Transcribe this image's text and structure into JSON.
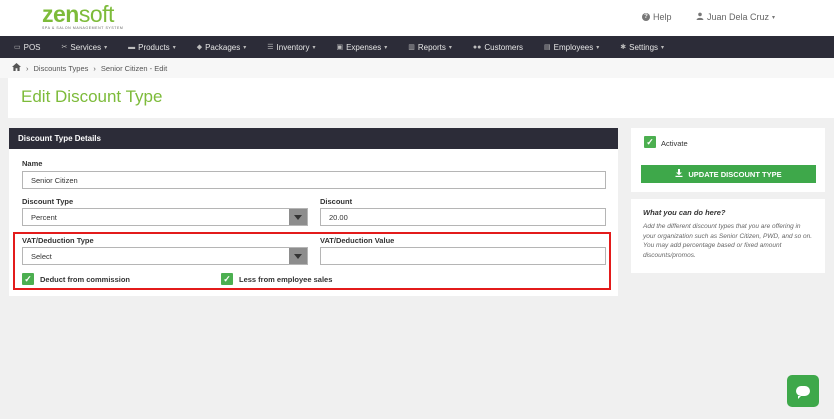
{
  "brand": {
    "name_part1": "zen",
    "name_part2": "soft",
    "tagline": "SPA & SALON MANAGEMENT SYSTEM"
  },
  "header": {
    "help_label": "Help",
    "user_name": "Juan Dela Cruz"
  },
  "nav": {
    "items": [
      {
        "icon": "tablet-icon",
        "label": "POS",
        "has_caret": false
      },
      {
        "icon": "wrench-icon",
        "label": "Services",
        "has_caret": true
      },
      {
        "icon": "cart-icon",
        "label": "Products",
        "has_caret": true
      },
      {
        "icon": "tag-icon",
        "label": "Packages",
        "has_caret": true
      },
      {
        "icon": "list-icon",
        "label": "Inventory",
        "has_caret": true
      },
      {
        "icon": "money-icon",
        "label": "Expenses",
        "has_caret": true
      },
      {
        "icon": "bar-chart-icon",
        "label": "Reports",
        "has_caret": true
      },
      {
        "icon": "users-icon",
        "label": "Customers",
        "has_caret": false
      },
      {
        "icon": "employees-icon",
        "label": "Employees",
        "has_caret": true
      },
      {
        "icon": "gear-icon",
        "label": "Settings",
        "has_caret": true
      }
    ]
  },
  "breadcrumb": {
    "items": [
      "Discounts Types",
      "Senior Citizen - Edit"
    ]
  },
  "page": {
    "title": "Edit Discount Type"
  },
  "form": {
    "panel_title": "Discount Type Details",
    "name_label": "Name",
    "name_value": "Senior Citizen",
    "discount_type_label": "Discount Type",
    "discount_type_value": "Percent",
    "discount_label": "Discount",
    "discount_value": "20.00",
    "vat_type_label": "VAT/Deduction Type",
    "vat_type_value": "Select",
    "vat_value_label": "VAT/Deduction Value",
    "vat_value_value": "",
    "deduct_commission_label": "Deduct from commission",
    "deduct_commission_checked": true,
    "less_employee_sales_label": "Less from employee sales",
    "less_employee_sales_checked": true
  },
  "sidebar": {
    "activate_label": "Activate",
    "activate_checked": true,
    "update_button_label": "UPDATE DISCOUNT TYPE",
    "info_title": "What you can do here?",
    "info_text": "Add the different discount types that you are offering in your organization such as Senior Citizen, PWD, and so on. You may add percentage based or fixed amount discounts/promos."
  },
  "colors": {
    "accent_green": "#7dbb3a",
    "button_green": "#3ea84a",
    "nav_bg": "#2c2c38",
    "highlight_red": "#e31b1b"
  }
}
